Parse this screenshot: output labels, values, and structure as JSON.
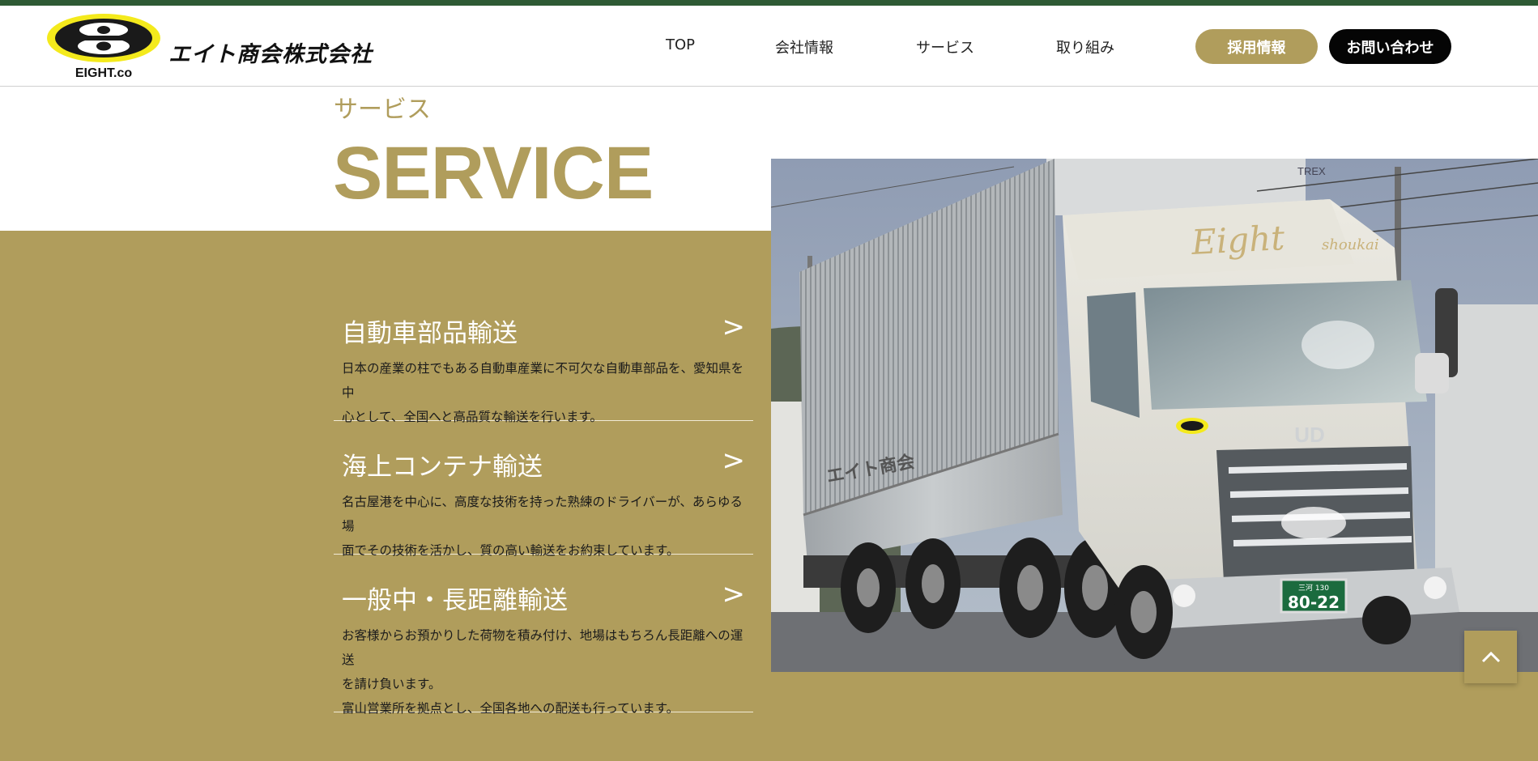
{
  "brand": {
    "emblem_text": "EIGHT.co",
    "company_name": "エイト商会株式会社"
  },
  "nav": {
    "items": [
      "TOP",
      "会社情報",
      "サービス",
      "取り組み"
    ],
    "recruit_label": "採用情報",
    "contact_label": "お問い合わせ"
  },
  "section": {
    "subtitle": "サービス",
    "title": "SERVICE"
  },
  "services": [
    {
      "title": "自動車部品輸送",
      "arrow": ">",
      "desc_lines": [
        "日本の産業の柱でもある自動車産業に不可欠な自動車部品を、愛知県を中",
        "心として、全国へと高品質な輸送を行います。"
      ]
    },
    {
      "title": "海上コンテナ輸送",
      "arrow": ">",
      "desc_lines": [
        "名古屋港を中心に、高度な技術を持った熟練のドライバーが、あらゆる場",
        "面でその技術を活かし、質の高い輸送をお約束しています。"
      ]
    },
    {
      "title": "一般中・長距離輸送",
      "arrow": ">",
      "desc_lines": [
        "お客様からお預かりした荷物を積み付け、地場はもちろん長距離への運送",
        "を請け負います。",
        "富山営業所を拠点とし、全国各地への配送も行っています。"
      ]
    }
  ],
  "photo": {
    "cab_script": "Eight",
    "cab_script_small": "shoukai",
    "body_text": "エイト商会",
    "plate_top": "三河 130",
    "plate_number": "80-22",
    "side_brand": "UD",
    "trailer_tag": "TREX"
  },
  "colors": {
    "accent_gold": "#b09d5c",
    "top_bar_green": "#2e5a34",
    "contact_black": "#050505"
  },
  "icons": {
    "to_top": "chevron-up-icon"
  }
}
